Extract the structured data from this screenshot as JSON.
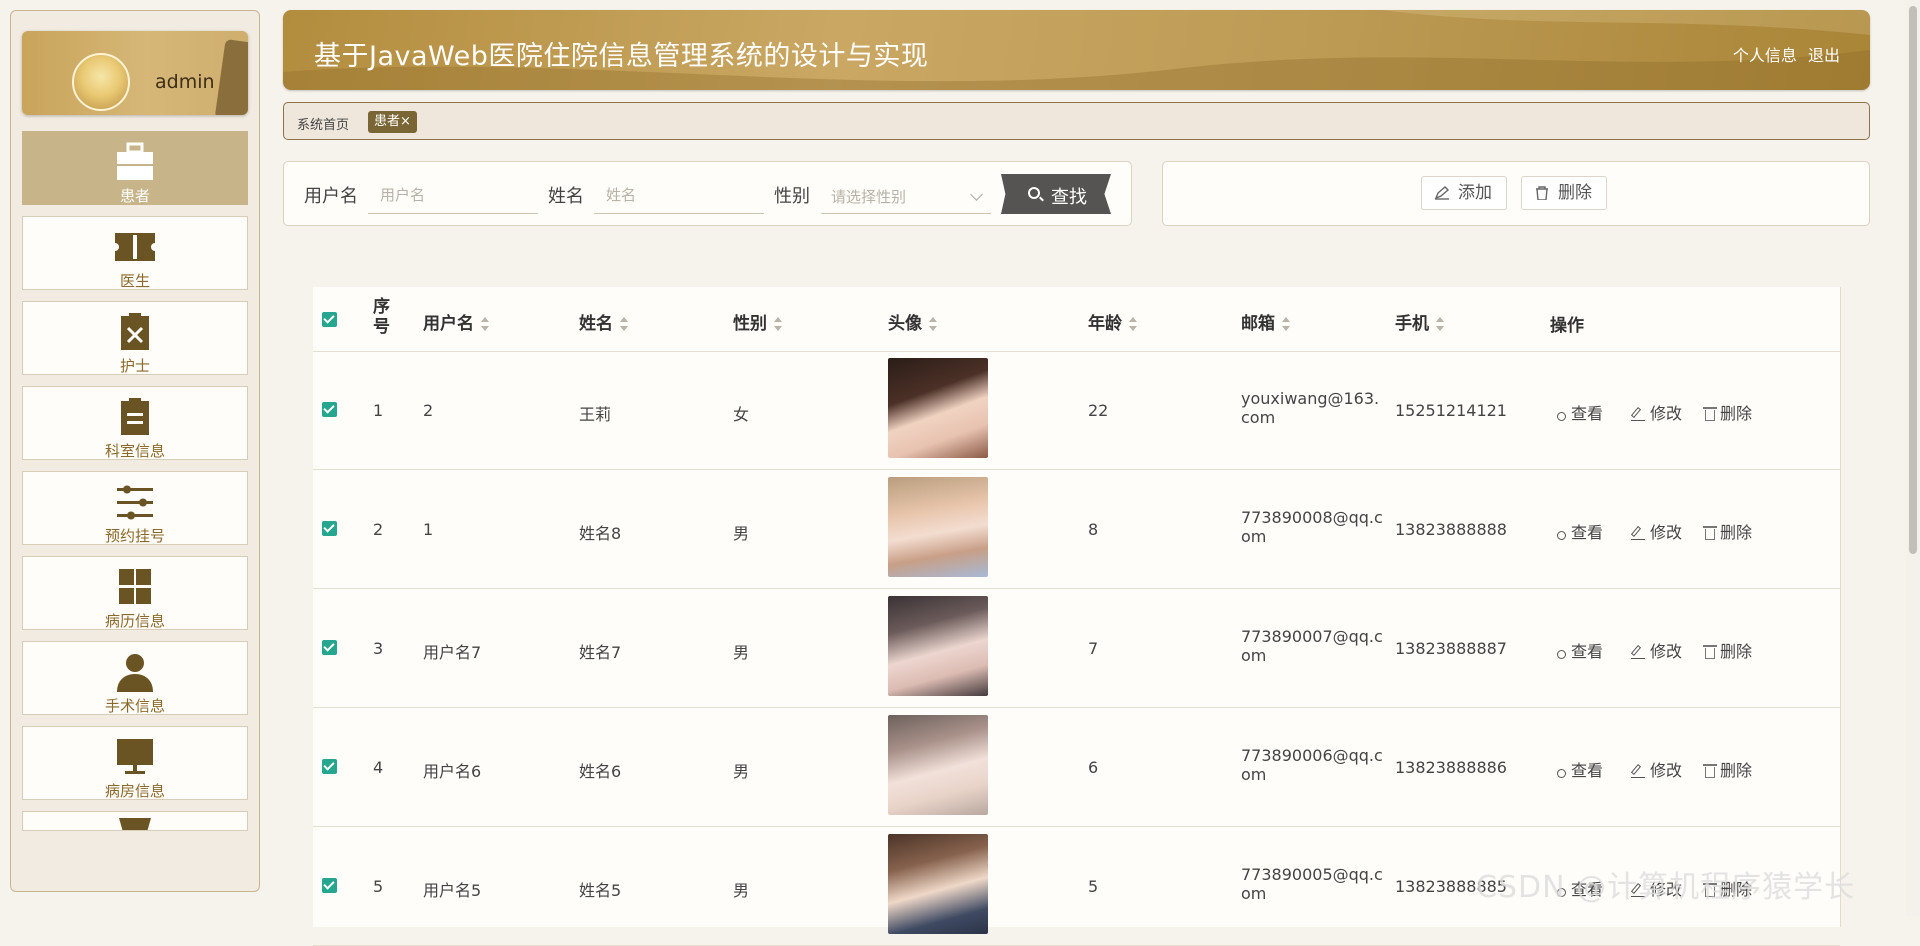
{
  "user": {
    "name": "admin"
  },
  "sidebar": {
    "items": [
      {
        "label": "患者",
        "icon": "briefcase-icon",
        "active": true
      },
      {
        "label": "医生",
        "icon": "ticket-icon"
      },
      {
        "label": "护士",
        "icon": "clipboard-x-icon"
      },
      {
        "label": "科室信息",
        "icon": "clipboard-icon"
      },
      {
        "label": "预约挂号",
        "icon": "sliders-icon"
      },
      {
        "label": "病历信息",
        "icon": "grid-icon"
      },
      {
        "label": "手术信息",
        "icon": "person-icon"
      },
      {
        "label": "病房信息",
        "icon": "monitor-icon"
      }
    ]
  },
  "header": {
    "title": "基于JavaWeb医院住院信息管理系统的设计与实现",
    "profile_link": "个人信息",
    "logout_link": "退出"
  },
  "breadcrumb": {
    "home": "系统首页",
    "current": "患者×"
  },
  "search": {
    "username_label": "用户名",
    "username_placeholder": "用户名",
    "name_label": "姓名",
    "name_placeholder": "姓名",
    "gender_label": "性别",
    "gender_placeholder": "请选择性别",
    "button": "查找"
  },
  "actions": {
    "add": "添加",
    "delete": "删除"
  },
  "table": {
    "headers": {
      "index": "序号",
      "username": "用户名",
      "name": "姓名",
      "gender": "性别",
      "avatar": "头像",
      "age": "年龄",
      "email": "邮箱",
      "phone": "手机",
      "ops": "操作"
    },
    "rows": [
      {
        "index": "1",
        "username": "2",
        "name": "王莉",
        "gender": "女",
        "age": "22",
        "email1": "youxiwang@163.",
        "email2": "com",
        "phone": "15251214121"
      },
      {
        "index": "2",
        "username": "1",
        "name": "姓名8",
        "gender": "男",
        "age": "8",
        "email1": "773890008@qq.c",
        "email2": "om",
        "phone": "13823888888"
      },
      {
        "index": "3",
        "username": "用户名7",
        "name": "姓名7",
        "gender": "男",
        "age": "7",
        "email1": "773890007@qq.c",
        "email2": "om",
        "phone": "13823888887"
      },
      {
        "index": "4",
        "username": "用户名6",
        "name": "姓名6",
        "gender": "男",
        "age": "6",
        "email1": "773890006@qq.c",
        "email2": "om",
        "phone": "13823888886"
      },
      {
        "index": "5",
        "username": "用户名5",
        "name": "姓名5",
        "gender": "男",
        "age": "5",
        "email1": "773890005@qq.c",
        "email2": "om",
        "phone": "13823888885"
      }
    ],
    "ops": {
      "view": "查看",
      "edit": "修改",
      "delete": "删除"
    }
  },
  "watermark": "CSDN @计算机程序猿学长",
  "colors": {
    "accent": "#b38d3e",
    "sidebar_active": "#c8b489",
    "checkbox": "#26a68f",
    "search_button": "#555453"
  }
}
